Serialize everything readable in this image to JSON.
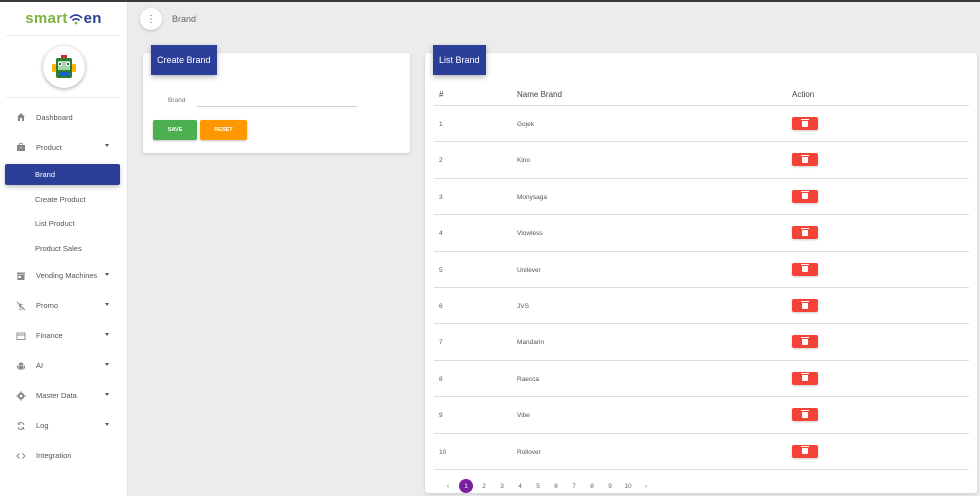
{
  "app": {
    "logo_part1": "smart",
    "logo_part2": "en"
  },
  "sidebar": {
    "items": [
      {
        "label": "Dashboard",
        "icon": "home-icon"
      },
      {
        "label": "Product",
        "icon": "briefcase-icon",
        "expanded": true
      },
      {
        "label": "Vending Machines",
        "icon": "store-icon"
      },
      {
        "label": "Promo",
        "icon": "dollar-off-icon"
      },
      {
        "label": "Finance",
        "icon": "wallet-icon"
      },
      {
        "label": "AI",
        "icon": "android-icon"
      },
      {
        "label": "Master Data",
        "icon": "gear-icon"
      },
      {
        "label": "Log",
        "icon": "sync-icon"
      },
      {
        "label": "Integration",
        "icon": "code-icon"
      }
    ],
    "product_sub": [
      {
        "label": "Brand",
        "active": true
      },
      {
        "label": "Create Product"
      },
      {
        "label": "List Product"
      },
      {
        "label": "Product Sales"
      }
    ]
  },
  "topbar": {
    "breadcrumb": "Brand"
  },
  "create_brand": {
    "title": "Create Brand",
    "field_label": "Brand",
    "field_value": "",
    "save_label": "SAVE",
    "reset_label": "RESET"
  },
  "list_brand": {
    "title": "List Brand",
    "columns": [
      "#",
      "Name Brand",
      "Action"
    ],
    "rows": [
      {
        "num": "1",
        "name": "Gojek"
      },
      {
        "num": "2",
        "name": "Kino"
      },
      {
        "num": "3",
        "name": "Monysaga"
      },
      {
        "num": "4",
        "name": "Vlowless"
      },
      {
        "num": "5",
        "name": "Unilever"
      },
      {
        "num": "6",
        "name": "JVS"
      },
      {
        "num": "7",
        "name": "Mandarin"
      },
      {
        "num": "8",
        "name": "Raecca"
      },
      {
        "num": "9",
        "name": "Vibe"
      },
      {
        "num": "10",
        "name": "Rollover"
      }
    ],
    "pagination": {
      "prev": "‹",
      "pages": [
        "1",
        "2",
        "3",
        "4",
        "5",
        "6",
        "7",
        "8",
        "9",
        "10"
      ],
      "next": "›",
      "current": "1"
    }
  },
  "colors": {
    "primary": "#2b3f99",
    "save": "#4caf50",
    "reset": "#ff9800",
    "delete": "#f44336",
    "page_active": "#7b1fa2"
  }
}
